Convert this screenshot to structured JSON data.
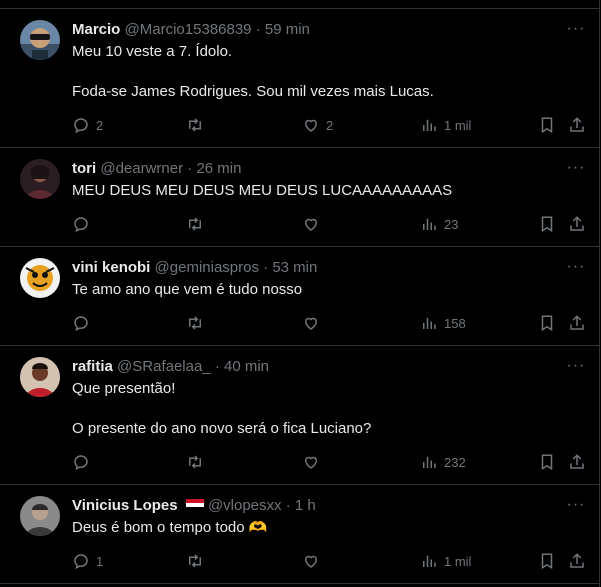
{
  "tweets": [
    {
      "name": "Marcio",
      "handle": "@Marcio15386839",
      "dot": "·",
      "time": "59 min",
      "lines": [
        "Meu 10 veste a 7. Ídolo.",
        "Foda-se James Rodrigues. Sou mil vezes mais Lucas."
      ],
      "replies": "2",
      "retweets": "",
      "likes": "2",
      "views": "1 mil",
      "avatar": "avatar-man-sunglasses"
    },
    {
      "name": "tori",
      "handle": "@dearwrner",
      "dot": "·",
      "time": "26 min",
      "lines": [
        "MEU DEUS MEU DEUS MEU DEUS LUCAAAAAAAAAS"
      ],
      "replies": "",
      "retweets": "",
      "likes": "",
      "views": "23",
      "avatar": "avatar-person-dark"
    },
    {
      "name": "vini kenobi",
      "handle": "@geminiaspros",
      "dot": "·",
      "time": "53 min",
      "lines": [
        "Te amo ano que vem é tudo nosso"
      ],
      "replies": "",
      "retweets": "",
      "likes": "",
      "views": "158",
      "avatar": "avatar-cartoon"
    },
    {
      "name": "rafitia",
      "handle": "@SRafaelaa_",
      "dot": "·",
      "time": "40 min",
      "lines": [
        "Que presentão!",
        "O presente do ano novo será o fica Luciano?"
      ],
      "replies": "",
      "retweets": "",
      "likes": "",
      "views": "232",
      "avatar": "avatar-woman-red"
    },
    {
      "name": "Vinicius Lopes",
      "handle": "@vlopesxx",
      "dot": "·",
      "time": "1 h",
      "lines": [
        "Deus é bom o tempo todo 🫶"
      ],
      "replies": "1",
      "retweets": "",
      "likes": "",
      "views": "1 mil",
      "avatar": "avatar-man-gray"
    }
  ],
  "icons": {
    "more": "more-dots-icon",
    "reply": "reply-icon",
    "retweet": "retweet-icon",
    "like": "heart-icon",
    "views": "views-icon",
    "bookmark": "bookmark-icon",
    "share": "share-icon"
  },
  "colors": {
    "background": "#000000",
    "text": "#e7e9ea",
    "muted": "#71767b",
    "border": "#2f3336"
  }
}
